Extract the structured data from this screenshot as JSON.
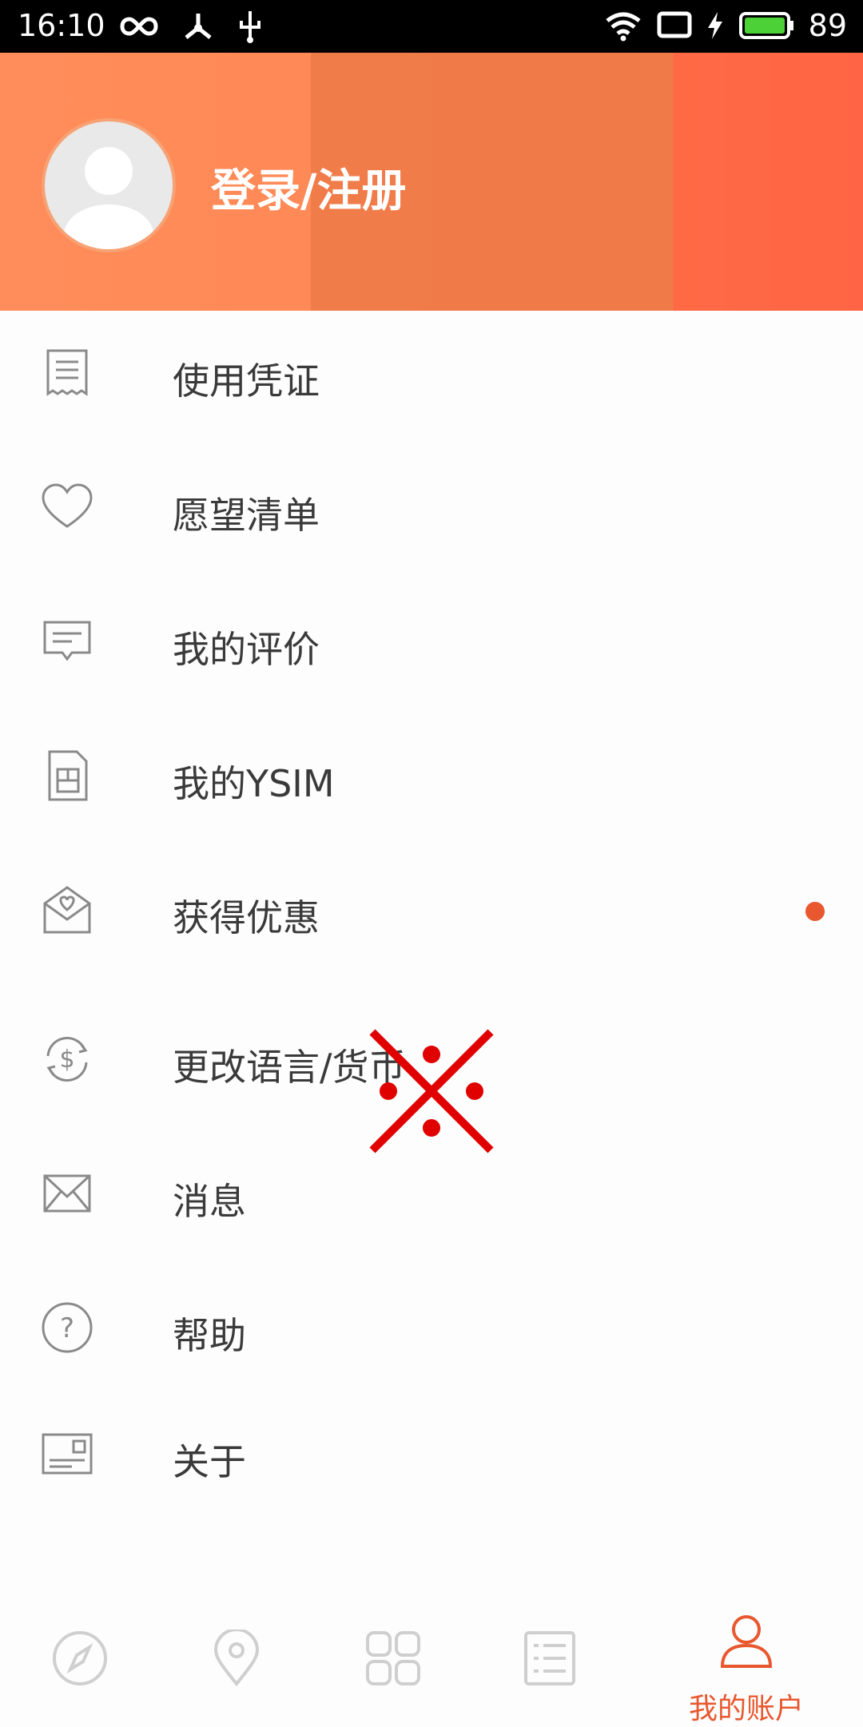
{
  "status_bar": {
    "time": "16:10",
    "battery": "89"
  },
  "header": {
    "login_label": "登录/注册"
  },
  "menu": {
    "items": [
      {
        "label": "使用凭证",
        "icon": "receipt-icon"
      },
      {
        "label": "愿望清单",
        "icon": "heart-icon"
      },
      {
        "label": "我的评价",
        "icon": "comment-icon"
      },
      {
        "label": "我的YSIM",
        "icon": "sim-card-icon"
      },
      {
        "label": "获得优惠",
        "icon": "gift-mail-icon"
      },
      {
        "label": "更改语言/货币",
        "icon": "currency-exchange-icon"
      },
      {
        "label": "消息",
        "icon": "mail-icon"
      },
      {
        "label": "帮助",
        "icon": "help-icon"
      },
      {
        "label": "关于",
        "icon": "info-card-icon"
      }
    ]
  },
  "bottom_nav": {
    "active_label": "我的账户"
  },
  "colors": {
    "accent": "#e8572e",
    "header_orange": "#ff8a57",
    "icon_gray": "#8a8a8a"
  }
}
